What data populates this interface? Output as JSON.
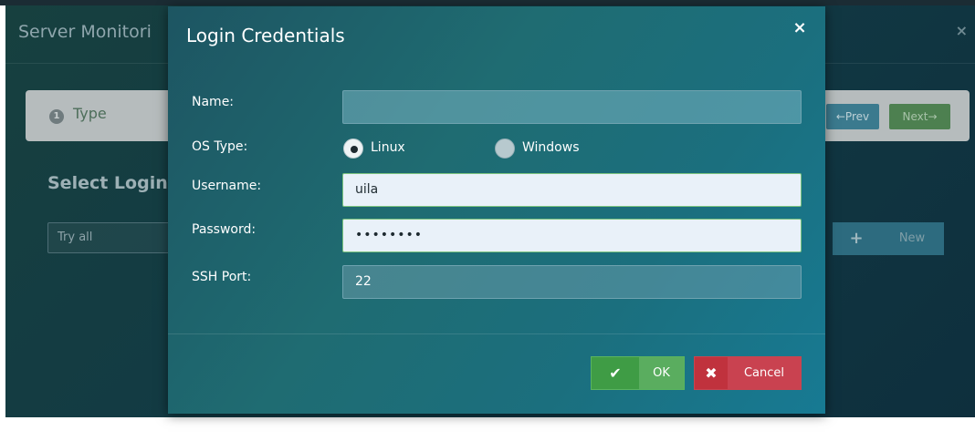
{
  "background": {
    "window_title": "Server Monitori",
    "steps": {
      "current_number": "1",
      "current_label": "Type"
    },
    "prev_label": "←Prev",
    "next_label": "Next→",
    "select_title": "Select Login",
    "selector_value": "Try all",
    "add_icon_glyph": "+",
    "new_label": "New",
    "close_glyph": "×"
  },
  "dialog": {
    "title": "Login Credentials",
    "close_glyph": "×",
    "form": {
      "name_label": "Name:",
      "name_value": "",
      "os_label": "OS Type:",
      "os_options": [
        {
          "label": "Linux",
          "selected": true
        },
        {
          "label": "Windows",
          "selected": false
        }
      ],
      "username_label": "Username:",
      "username_value": "uila",
      "password_label": "Password:",
      "password_value": "••••••••",
      "ssh_port_label": "SSH Port:",
      "ssh_port_value": "22"
    },
    "buttons": {
      "ok_icon": "✔",
      "ok_label": "OK",
      "cancel_icon": "✖",
      "cancel_label": "Cancel"
    }
  },
  "colors": {
    "ok_green": "#5aad5f",
    "cancel_red": "#c94250",
    "dialog_teal": "#1f6c72"
  }
}
